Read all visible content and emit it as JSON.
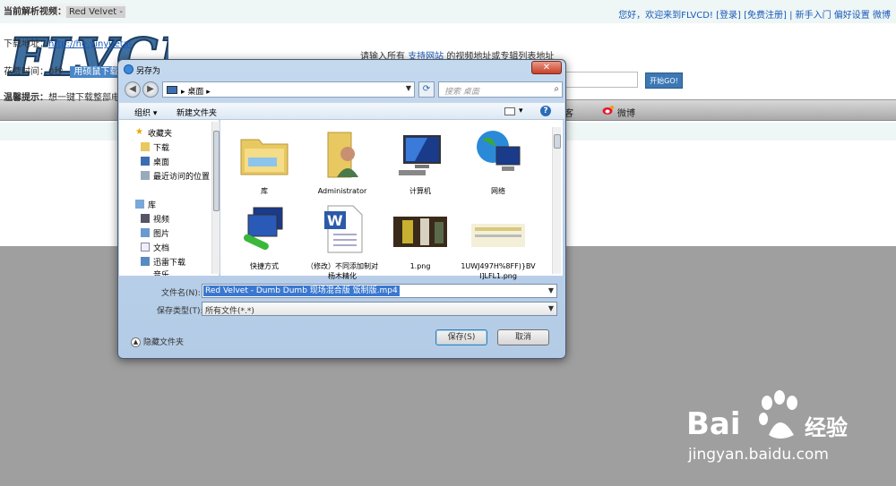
{
  "site": {
    "header_links": "您好，欢迎来到FLVCD! [登录] [免费注册] | 新手入门  偏好设置  微博",
    "logo_text": "FLVCD",
    "prompt_prefix": "请输入所有",
    "prompt_link": "支持网站",
    "prompt_suffix": "的视频地址或专辑列表地址",
    "go_button": "开始GO!",
    "nav_items": [
      "客",
      "微博"
    ],
    "result": {
      "current_label": "当前解析视频：",
      "current_value": "Red Velvet - ",
      "download_label": "下载地址：",
      "download_url": "http://he.yinyuetai",
      "time_label": "花费时间：0秒",
      "time_button": "用硕鼠下载",
      "tip_label": "温馨提示：",
      "tip_text": "想一键下载整部电"
    }
  },
  "watermark": {
    "brand": "Bai",
    "jingyan": "经验",
    "url": "jingyan.baidu.com"
  },
  "dialog": {
    "title": "另存为",
    "close": "✕",
    "address": "桌面",
    "search_placeholder": "搜索 桌面",
    "toolbar": {
      "organize": "组织 ▾",
      "new_folder": "新建文件夹"
    },
    "nav_pane": [
      {
        "label": "收藏夹",
        "icon": "star-icon"
      },
      {
        "label": "下载",
        "icon": "download-folder-icon"
      },
      {
        "label": "桌面",
        "icon": "desktop-icon"
      },
      {
        "label": "最近访问的位置",
        "icon": "recent-places-icon"
      },
      {
        "label": "库",
        "icon": "library-icon"
      },
      {
        "label": "视频",
        "icon": "video-icon"
      },
      {
        "label": "图片",
        "icon": "picture-icon"
      },
      {
        "label": "文档",
        "icon": "document-icon"
      },
      {
        "label": "迅雷下载",
        "icon": "thunder-download-icon"
      },
      {
        "label": "音乐",
        "icon": "music-icon"
      }
    ],
    "files": [
      {
        "label": "库",
        "icon": "library-folder-icon"
      },
      {
        "label": "Administrator",
        "icon": "user-folder-icon"
      },
      {
        "label": "计算机",
        "icon": "computer-icon"
      },
      {
        "label": "网络",
        "icon": "network-icon"
      },
      {
        "label": "快捷方式",
        "icon": "shortcut-icon"
      },
      {
        "label": "（修改）不同添加制对杨木精化",
        "icon": "word-document-icon"
      },
      {
        "label": "1.png",
        "icon": "image-thumbnail-icon"
      },
      {
        "label": "1UWJ497H%8FF)}BVI]LFL1.png",
        "icon": "image-thumbnail-icon"
      }
    ],
    "filename_label": "文件名(N):",
    "filename_value": "Red Velvet - Dumb Dumb 现场混合版 饭制版.mp4",
    "filetype_label": "保存类型(T):",
    "filetype_value": "所有文件(*.*)",
    "hide_folders": "隐藏文件夹",
    "save_button": "保存(S)",
    "cancel_button": "取消"
  }
}
